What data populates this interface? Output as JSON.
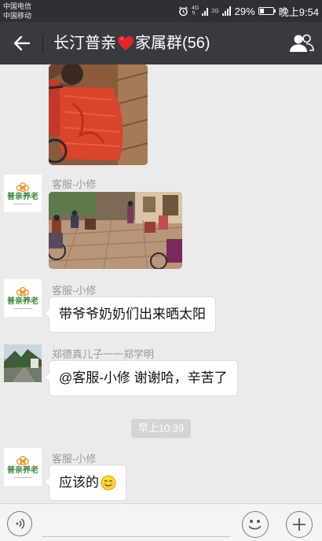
{
  "status_bar": {
    "carrier_1": "中国电信",
    "carrier_2": "中国移动",
    "net_1": "4G",
    "net_2": "2G",
    "battery_percent": "29%",
    "battery_level": 0.29,
    "time": "晚上9:54"
  },
  "header": {
    "title_before": "长汀普亲",
    "title_after": "家属群(56)"
  },
  "logo": {
    "text": "普亲养老"
  },
  "messages": [
    {
      "type": "image",
      "sender": "",
      "avatar": "none",
      "content": ""
    },
    {
      "type": "image",
      "sender": "客服-小修",
      "avatar": "logo",
      "content": ""
    },
    {
      "type": "text",
      "sender": "客服-小修",
      "avatar": "logo",
      "content": "带爷爷奶奶们出来晒太阳"
    },
    {
      "type": "text",
      "sender": "郑德真儿子一一郑学明",
      "avatar": "photo",
      "content": "@客服-小修 谢谢哈，辛苦了"
    },
    {
      "type": "time",
      "content": "早上10:39"
    },
    {
      "type": "text",
      "sender": "客服-小修",
      "avatar": "logo",
      "content": "应该的",
      "emoji": "smile-emoji"
    }
  ],
  "input": {
    "placeholder": ""
  },
  "colors": {
    "header_bg": "#393a3f",
    "status_bg": "#2f3034",
    "chat_bg": "#ebebeb",
    "heart": "#e0262f",
    "logo_green": "#3c8a3a"
  }
}
